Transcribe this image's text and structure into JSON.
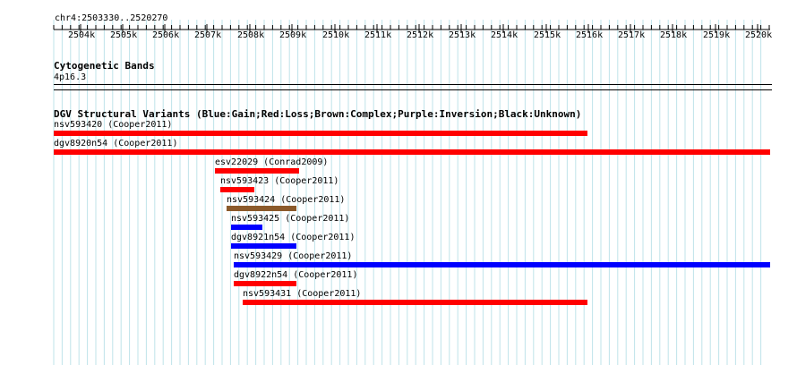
{
  "locus": "chr4:2503330..2520270",
  "ruler": {
    "ticks": [
      "2504k",
      "2505k",
      "2506k",
      "2507k",
      "2508k",
      "2509k",
      "2510k",
      "2511k",
      "2512k",
      "2513k",
      "2514k",
      "2515k",
      "2516k",
      "2517k",
      "2518k",
      "2519k",
      "2520k"
    ]
  },
  "cytoband": {
    "title": "Cytogenetic Bands",
    "band": "4p16.3"
  },
  "dgv": {
    "title": "DGV Structural Variants (Blue:Gain;Red:Loss;Brown:Complex;Purple:Inversion;Black:Unknown)",
    "colors": {
      "gain": "#0000ff",
      "loss": "#ff0000",
      "complex": "#8b5a2b",
      "inversion": "#800080",
      "unknown": "#000000"
    },
    "features": [
      {
        "label": "nsv593420 (Cooper2011)",
        "type": "loss"
      },
      {
        "label": "dgv8920n54 (Cooper2011)",
        "type": "loss"
      },
      {
        "label": "esv22029 (Conrad2009)",
        "type": "loss"
      },
      {
        "label": "nsv593423 (Cooper2011)",
        "type": "loss"
      },
      {
        "label": "nsv593424 (Cooper2011)",
        "type": "complex"
      },
      {
        "label": "nsv593425 (Cooper2011)",
        "type": "gain"
      },
      {
        "label": "dgv8921n54 (Cooper2011)",
        "type": "gain"
      },
      {
        "label": "nsv593429 (Cooper2011)",
        "type": "gain"
      },
      {
        "label": "dgv8922n54 (Cooper2011)",
        "type": "loss"
      },
      {
        "label": "nsv593431 (Cooper2011)",
        "type": "loss"
      }
    ]
  }
}
